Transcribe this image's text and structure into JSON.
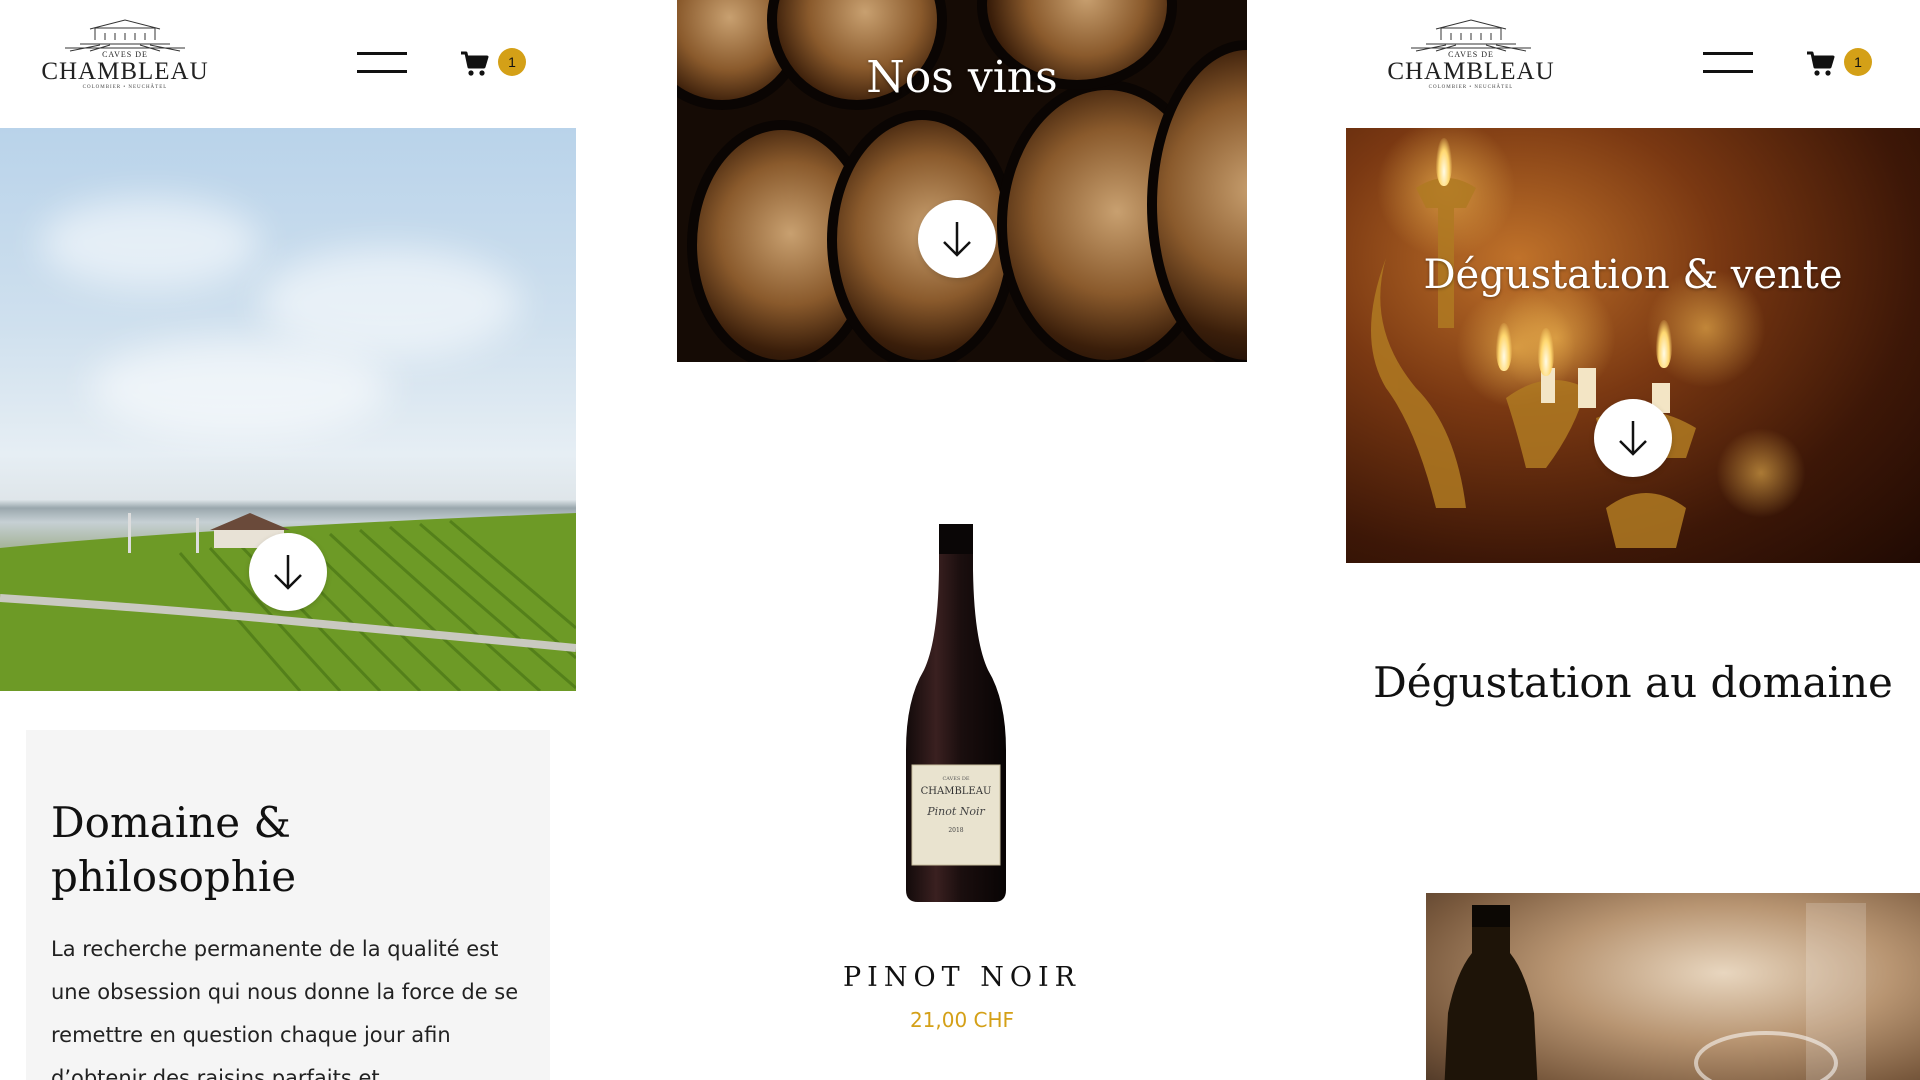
{
  "brand": {
    "caves": "CAVES DE",
    "name": "CHAMBLEAU",
    "location": "COLOMBIER • NEUCHÂTEL"
  },
  "header": {
    "cart_count": "1"
  },
  "colors": {
    "accent": "#d4a017",
    "card_bg": "#f5f5f5"
  },
  "icons": {
    "menu": "hamburger-icon",
    "cart": "cart-icon",
    "arrow": "arrow-down-icon"
  },
  "panels": {
    "domaine": {
      "title": "Domaine & philosophie",
      "text": "La recherche permanente de la qualité est une obsession qui nous donne la force de se remettre en question chaque jour afin d’obtenir des raisins parfaits et"
    },
    "vins": {
      "hero_title": "Nos vins",
      "product_name": "PINOT NOIR",
      "product_price": "21,00 CHF",
      "bottle_label_brand": "CHAMBLEAU",
      "bottle_label_wine": "Pinot Noir",
      "bottle_label_year": "2018"
    },
    "degustation": {
      "hero_title": "Dégustation & vente",
      "section_title": "Dégustation au domaine"
    }
  }
}
